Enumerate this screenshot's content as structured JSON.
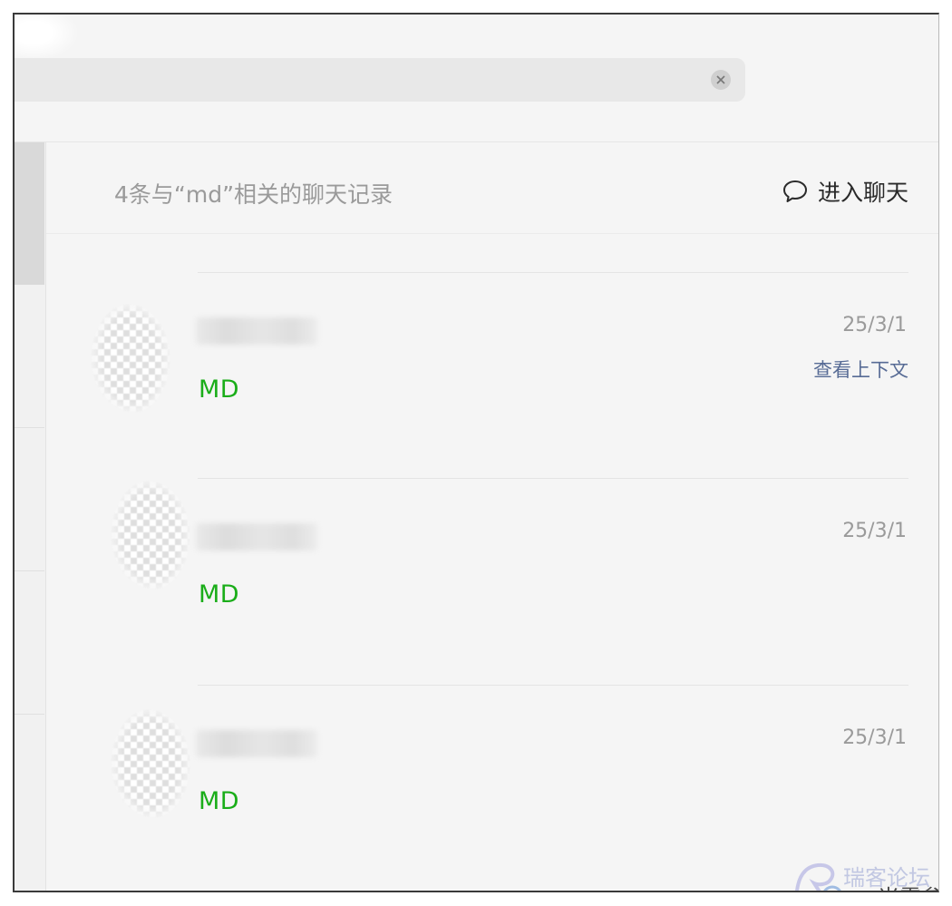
{
  "search": {
    "value": "",
    "clear_icon": "close-icon"
  },
  "header": {
    "result_count": "4条与“md”相关的聊天记录",
    "enter_chat_label": "进入聊天",
    "enter_chat_icon": "chat-bubble-icon"
  },
  "results": [
    {
      "snippet": "MD",
      "date": "25/3/1",
      "context_link": "查看上下文"
    },
    {
      "snippet": "MD",
      "date": "25/3/1"
    },
    {
      "snippet": "MD",
      "date": "25/3/1"
    }
  ],
  "watermark": {
    "line1": "瑞客论坛",
    "line2": "米零叁"
  },
  "colors": {
    "highlight": "#1aad19",
    "link": "#576b95",
    "muted": "#9a9a9a"
  }
}
